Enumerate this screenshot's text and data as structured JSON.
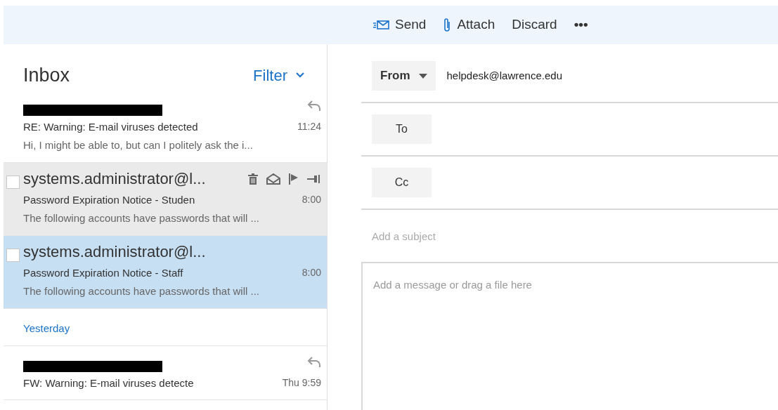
{
  "toolbar": {
    "actions": [
      {
        "kind": "send",
        "label": "Send"
      },
      {
        "kind": "attach",
        "label": "Attach"
      },
      {
        "kind": "plain",
        "label": "Discard"
      },
      {
        "kind": "more",
        "label": "•••"
      }
    ]
  },
  "inbox": {
    "title": "Inbox",
    "filter": "Filter",
    "groups": [
      {
        "messages": [
          {
            "kind": "redacted",
            "subject": "RE: Warning: E-mail viruses detected",
            "time": "11:24",
            "preview": "Hi, I might be able to, but can I politely ask the i...",
            "replied": true,
            "hovered": false,
            "selected": false
          },
          {
            "kind": "named",
            "sender": "systems.administrator@l...",
            "subject": "Password Expiration Notice - Studen",
            "time": "8:00",
            "preview": "The following accounts have passwords that will ...",
            "replied": false,
            "hovered": true,
            "selected": false
          },
          {
            "kind": "named",
            "sender": "systems.administrator@l...",
            "subject": "Password Expiration Notice - Staff",
            "time": "8:00",
            "preview": "The following accounts have passwords that will ...",
            "replied": false,
            "hovered": false,
            "selected": true
          }
        ]
      },
      {
        "label": "Yesterday",
        "messages": [
          {
            "kind": "redacted",
            "subject": "FW: Warning: E-mail viruses detecte",
            "time": "Thu 9:59",
            "replied": true,
            "hovered": false,
            "selected": false
          }
        ]
      }
    ]
  },
  "compose": {
    "from_label": "From",
    "from_value": "helpdesk@lawrence.edu",
    "to_label": "To",
    "cc_label": "Cc",
    "subject_placeholder": "Add a subject",
    "body_placeholder": "Add a message or drag a file here"
  }
}
